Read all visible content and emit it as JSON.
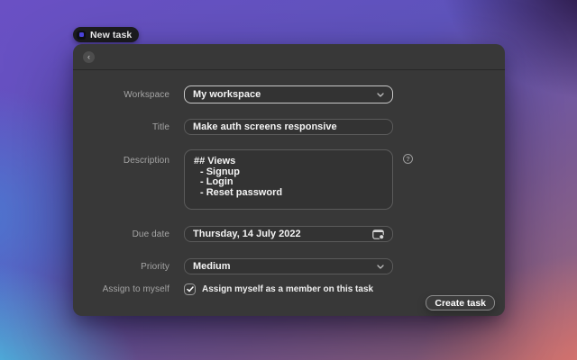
{
  "tag": {
    "label": "New task",
    "accent_color": "#4f46e5"
  },
  "modal": {
    "background_color": "#383838",
    "icons": {
      "back": "chevron-left",
      "workspace_dropdown": "chevron-down",
      "priority_dropdown": "chevron-down",
      "due_date": "calendar",
      "description_help": "question-mark-circle",
      "checkbox": "checkmark"
    },
    "back_glyph": "‹",
    "help_glyph": "?",
    "form": {
      "workspace": {
        "label": "Workspace",
        "value": "My workspace"
      },
      "title": {
        "label": "Title",
        "value": "Make auth screens responsive"
      },
      "description": {
        "label": "Description",
        "heading": "## Views",
        "items": [
          "- Signup",
          "- Login",
          "- Reset password"
        ]
      },
      "due_date": {
        "label": "Due date",
        "value": "Thursday, 14 July 2022"
      },
      "priority": {
        "label": "Priority",
        "value": "Medium"
      },
      "assign": {
        "label": "Assign to myself",
        "checkbox_label": "Assign myself as a member on this task",
        "checked": true
      }
    },
    "create_button_label": "Create task"
  }
}
